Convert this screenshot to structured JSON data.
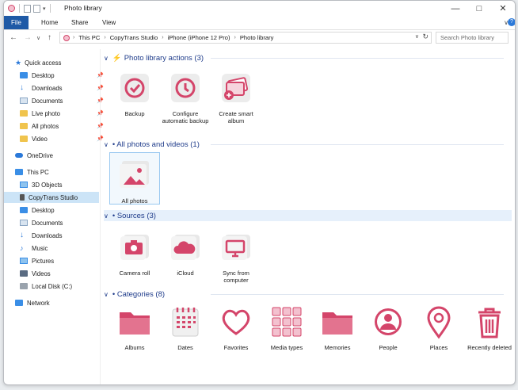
{
  "window": {
    "title": "Photo library"
  },
  "colors": {
    "accent": "#d4456a",
    "file_tab": "#1f5aa6",
    "group_header": "#1e3b8a",
    "selection": "#cce4f7"
  },
  "ribbon": {
    "tabs": [
      "File",
      "Home",
      "Share",
      "View"
    ]
  },
  "address": {
    "crumbs": [
      "This PC",
      "CopyTrans Studio",
      "iPhone (iPhone 12 Pro)",
      "Photo library"
    ],
    "search_placeholder": "Search Photo library"
  },
  "sidebar": {
    "items": [
      {
        "label": "Quick access",
        "icon": "star-icon"
      },
      {
        "label": "Desktop",
        "icon": "desktop-icon",
        "pinned": true
      },
      {
        "label": "Downloads",
        "icon": "download-icon",
        "pinned": true
      },
      {
        "label": "Documents",
        "icon": "documents-icon",
        "pinned": true
      },
      {
        "label": "Live photo",
        "icon": "folder-icon",
        "pinned": true
      },
      {
        "label": "All photos",
        "icon": "folder-icon",
        "pinned": true
      },
      {
        "label": "Video",
        "icon": "folder-icon",
        "pinned": true
      },
      {
        "label": "OneDrive",
        "icon": "cloud-icon"
      },
      {
        "label": "This PC",
        "icon": "computer-icon"
      },
      {
        "label": "3D Objects",
        "icon": "cube-icon"
      },
      {
        "label": "CopyTrans Studio",
        "icon": "phone-icon",
        "selected": true
      },
      {
        "label": "Desktop",
        "icon": "desktop-icon"
      },
      {
        "label": "Documents",
        "icon": "documents-icon"
      },
      {
        "label": "Downloads",
        "icon": "download-icon"
      },
      {
        "label": "Music",
        "icon": "music-icon"
      },
      {
        "label": "Pictures",
        "icon": "pictures-icon"
      },
      {
        "label": "Videos",
        "icon": "video-icon"
      },
      {
        "label": "Local Disk (C:)",
        "icon": "disk-icon"
      },
      {
        "label": "Network",
        "icon": "network-icon"
      }
    ]
  },
  "groups": [
    {
      "title": "Photo library actions (3)",
      "tiles": [
        {
          "label": "Backup",
          "icon": "backup-icon"
        },
        {
          "label": "Configure automatic backup",
          "icon": "auto-backup-icon"
        },
        {
          "label": "Create smart album",
          "icon": "smart-album-icon"
        }
      ]
    },
    {
      "title": "• All photos and videos (1)",
      "tiles": [
        {
          "label": "All photos",
          "icon": "photos-icon"
        }
      ]
    },
    {
      "title": "• Sources (3)",
      "tiles": [
        {
          "label": "Camera roll",
          "icon": "camera-icon"
        },
        {
          "label": "iCloud",
          "icon": "icloud-icon"
        },
        {
          "label": "Sync from computer",
          "icon": "monitor-icon"
        }
      ]
    },
    {
      "title": "• Categories (8)",
      "tiles": [
        {
          "label": "Albums",
          "icon": "folder-icon"
        },
        {
          "label": "Dates",
          "icon": "calendar-icon"
        },
        {
          "label": "Favorites",
          "icon": "heart-icon"
        },
        {
          "label": "Media types",
          "icon": "media-types-icon"
        },
        {
          "label": "Memories",
          "icon": "folder-icon"
        },
        {
          "label": "People",
          "icon": "person-icon"
        },
        {
          "label": "Places",
          "icon": "location-pin-icon"
        },
        {
          "label": "Recently deleted",
          "icon": "trash-icon"
        }
      ]
    }
  ]
}
